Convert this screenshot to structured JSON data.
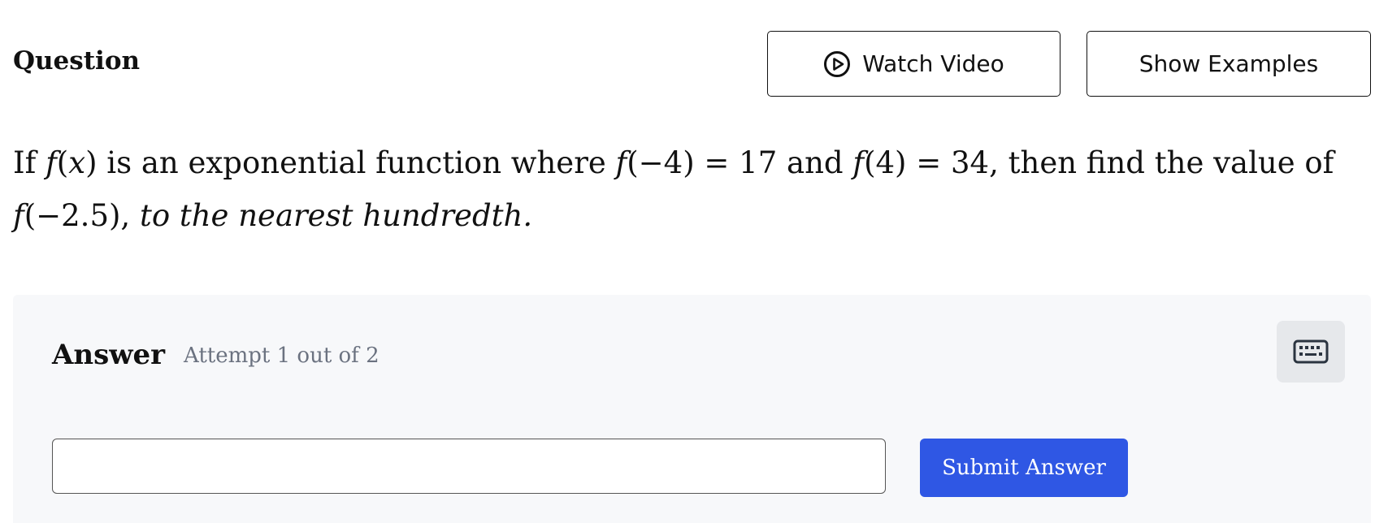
{
  "header": {
    "title": "Question",
    "watch_video_label": "Watch Video",
    "show_examples_label": "Show Examples"
  },
  "question": {
    "p1": "If ",
    "f1": "f",
    "p2": "(",
    "x1": "x",
    "p3": ") is an exponential function where ",
    "f2": "f",
    "p4": "(−4) = 17 and ",
    "f3": "f",
    "p5": "(4) = 34, then find the value of ",
    "f4": "f",
    "p6": "(−2.5), ",
    "emphasis": "to the nearest hundredth."
  },
  "answer": {
    "label": "Answer",
    "attempt_text": "Attempt 1 out of 2",
    "input_value": "",
    "input_placeholder": "",
    "submit_label": "Submit Answer"
  },
  "icons": {
    "play": "play-circle-icon",
    "keyboard": "keyboard-icon"
  },
  "colors": {
    "primary_button": "#2f57e4",
    "panel_background": "#f7f8fa",
    "muted_text": "#6b7280",
    "keyboard_button_bg": "#e6e8eb"
  }
}
